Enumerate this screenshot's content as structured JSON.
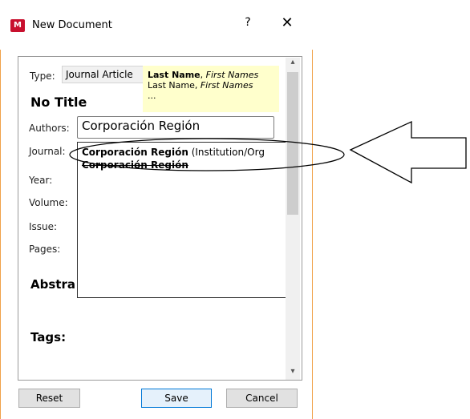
{
  "window": {
    "title": "New Document",
    "logo_text": "M",
    "help_label": "?",
    "close_label": "✕"
  },
  "form": {
    "type_label": "Type:",
    "type_value": "Journal Article",
    "doc_title": "No Title",
    "authors_label": "Authors:",
    "authors_value": "Corporación Región",
    "journal_label": "Journal:",
    "year_label": "Year:",
    "volume_label": "Volume:",
    "issue_label": "Issue:",
    "pages_label": "Pages:",
    "abstract_label": "Abstra",
    "tags_label": "Tags:"
  },
  "tooltip": {
    "line1_bold": "Last Name",
    "line1_rest": ", ",
    "line1_italic": "First Names",
    "line2_plain": "Last Name, ",
    "line2_italic": "First Names",
    "line3": "..."
  },
  "dropdown": {
    "items": [
      {
        "bold": "Corporación Región",
        "rest": " (Institution/Org"
      },
      {
        "bold": "Corporación Región"
      }
    ]
  },
  "buttons": {
    "reset": "Reset",
    "save": "Save",
    "cancel": "Cancel"
  },
  "scrollbar": {
    "up": "▴",
    "down": "▾"
  }
}
